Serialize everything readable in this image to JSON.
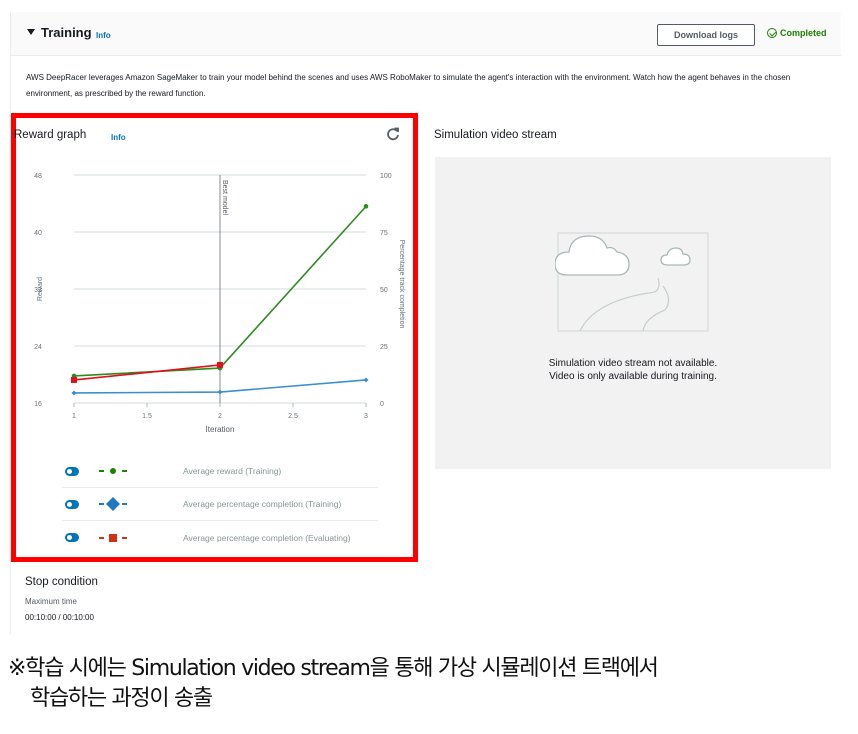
{
  "panel": {
    "title": "Training",
    "info_label": "Info",
    "download_button": "Download logs",
    "status": "Completed",
    "status_color": "#1d8102",
    "description": "AWS DeepRacer leverages Amazon SageMaker to train your model behind the scenes and uses AWS RoboMaker to simulate the agent's interaction with the environment. Watch how the agent behaves in the chosen environment, as prescribed by the reward function."
  },
  "reward_graph": {
    "title": "Reward graph",
    "info_label": "Info",
    "legend": [
      {
        "label": "Average reward (Training)",
        "marker": "circle",
        "color": "#1d8102",
        "enabled": true
      },
      {
        "label": "Average percentage completion (Training)",
        "marker": "diamond",
        "color": "#1f78c1",
        "enabled": true
      },
      {
        "label": "Average percentage completion (Evaluating)",
        "marker": "square",
        "color": "#d13212",
        "enabled": true
      }
    ]
  },
  "chart_data": {
    "type": "line",
    "title": "Reward graph",
    "xlabel": "Iteration",
    "ylabel": "Reward",
    "y2label": "Percentage track completion",
    "x": [
      1,
      2,
      3
    ],
    "xlim": [
      1,
      3
    ],
    "xticks": [
      "1",
      "1.5",
      "2",
      "2.5",
      "3"
    ],
    "ylim": [
      16,
      48
    ],
    "yticks": [
      "16",
      "24",
      "32",
      "40",
      "48"
    ],
    "y2lim": [
      0,
      100
    ],
    "y2ticks": [
      "0",
      "25",
      "50",
      "75",
      "100"
    ],
    "grid": true,
    "annotation": {
      "label": "Best model",
      "x": 2
    },
    "series": [
      {
        "name": "Average reward (Training)",
        "axis": "left",
        "color": "#2e8b1f",
        "marker": "circle",
        "x": [
          1,
          2,
          3
        ],
        "values": [
          19.8,
          20.9,
          43.6
        ]
      },
      {
        "name": "Average percentage completion (Training)",
        "axis": "right",
        "color": "#3a8fd0",
        "marker": "diamond",
        "x": [
          1,
          2,
          3
        ],
        "values": [
          4.4,
          4.8,
          10.1
        ]
      },
      {
        "name": "Average percentage completion (Evaluating)",
        "axis": "right",
        "color": "#e0101c",
        "marker": "square",
        "x": [
          1,
          2
        ],
        "values": [
          10.1,
          16.7
        ]
      }
    ]
  },
  "simulation": {
    "title": "Simulation video stream",
    "message_line1": "Simulation video stream not available.",
    "message_line2": "Video is only available during training."
  },
  "stop_condition": {
    "title": "Stop condition",
    "label": "Maximum time",
    "value": "00:10:00 / 00:10:00"
  },
  "note": {
    "line1": "※학습 시에는 Simulation video stream을 통해 가상 시뮬레이션 트랙에서",
    "line2": "학습하는 과정이 송출"
  }
}
